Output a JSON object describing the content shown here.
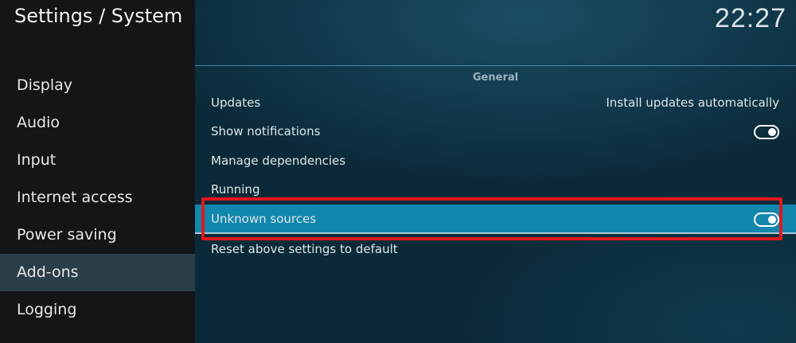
{
  "window": {
    "title": "Settings / System",
    "clock": "22:27"
  },
  "sidebar": {
    "items": [
      {
        "label": "Display"
      },
      {
        "label": "Audio"
      },
      {
        "label": "Input"
      },
      {
        "label": "Internet access"
      },
      {
        "label": "Power saving"
      },
      {
        "label": "Add-ons",
        "selected": true
      },
      {
        "label": "Logging"
      }
    ]
  },
  "main": {
    "section_title": "General",
    "settings": [
      {
        "label": "Updates",
        "value": "Install updates automatically"
      },
      {
        "label": "Show notifications",
        "toggle": "on"
      },
      {
        "label": "Manage dependencies"
      },
      {
        "label": "Running"
      },
      {
        "label": "Unknown sources",
        "toggle": "on",
        "focused": true
      },
      {
        "label": "Reset above settings to default"
      }
    ]
  },
  "colors": {
    "highlight_box": "#e0171c",
    "focused_row": "#1287ad",
    "sidebar_selected": "#2a3e48"
  }
}
